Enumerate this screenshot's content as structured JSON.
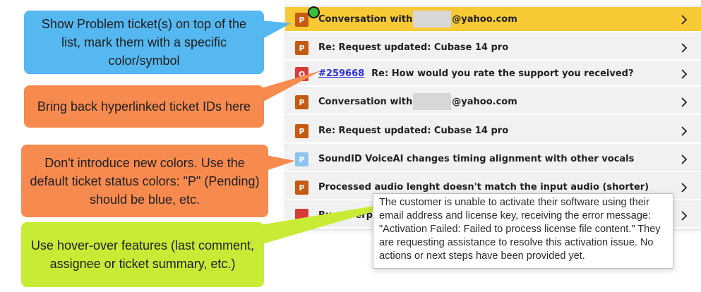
{
  "colors": {
    "pending_orange": "#c55a11",
    "open_red": "#d63b3b",
    "pending_blue": "#8fc4f0",
    "highlight_yellow": "#f7c935",
    "link_blue": "#2b2fd8"
  },
  "tickets": [
    {
      "status": "P",
      "color": "#c55a11",
      "pre": "Conversation with",
      "post": "@yahoo.com",
      "highlighted": true
    },
    {
      "status": "P",
      "color": "#c55a11",
      "text": "Re: Request updated: Cubase 14 pro"
    },
    {
      "status": "O",
      "color": "#d63b3b",
      "id_link": "#259668",
      "text": "Re: How would you rate the support you received?"
    },
    {
      "status": "P",
      "color": "#c55a11",
      "pre": "Conversation with",
      "post": "@yahoo.com"
    },
    {
      "status": "P",
      "color": "#c55a11",
      "text": "Re: Request updated: Cubase 14 pro"
    },
    {
      "status": "P",
      "color": "#8fc4f0",
      "text": "SoundID VoiceAI changes timing alignment with other vocals"
    },
    {
      "status": "P",
      "color": "#c55a11",
      "text": "Processed audio lenght doesn't match the input audio (shorter)"
    },
    {
      "status": "",
      "color": "#d63b3b",
      "text": "Bug - Perpe"
    }
  ],
  "callouts": {
    "problem_tickets": "Show Problem ticket(s) on top of the list, mark them with a specific color/symbol",
    "hyperlinks": "Bring back hyperlinked ticket IDs here",
    "colors": "Don't introduce new colors. Use the default ticket status colors: \"P\" (Pending) should be blue, etc.",
    "hover": "Use hover-over features (last comment, assignee or ticket summary, etc.)"
  },
  "tooltip": "The customer is unable to activate their software using their email address and license key, receiving the error message: \"Activation Failed: Failed to process license file content.\" They are requesting assistance to resolve this activation issue. No actions or next steps have been provided yet.",
  "icons": {
    "chevron": "chevron-right-icon",
    "marker": "problem-marker-icon"
  }
}
